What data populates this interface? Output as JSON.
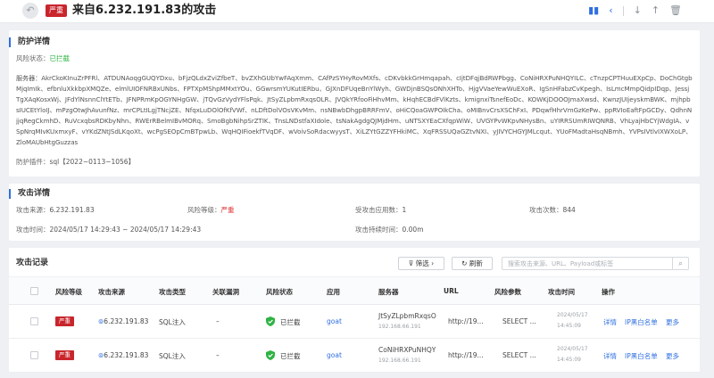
{
  "header": {
    "severity": "严重",
    "title": "来自6.232.191.83的攻击",
    "icons": [
      "bar-chart-icon",
      "chevron-left-icon",
      "arrow-down-icon",
      "arrow-up-icon",
      "trash-icon"
    ]
  },
  "defense": {
    "title": "防护详情",
    "status_label": "风险状态：",
    "status_value": "已拦截",
    "servers_label": "服务器：",
    "servers": "AkrCkoKInuZrPFRl、ATDUNAoqgGUQYDxu、bFjzQLdxZviZfbeT、bvZXhGUbYwFAqXmm、CAfPzSYHyRovMXfs、cDKvbkkGrHmqapah、cIjtDFqjBdRWPbgg、CoNiHRXPuNHQYILC、cTnzpCPTHuuEXpCp、DoChGtgbMjqImIk、efbnluXkkbpXMQZe、elmlUIOFNRBxUNbs、FPTXpMShpMMxtYOu、GGwrsmYUKutIERbu、GJXnDFUqeBnYlWyh、GWDjnBSQsONhXHTo、HjgVVaeYewWuEXoR、IgSnHFabzCvKpegh、IsLmcMmpQidpIDqp、JessjTgXAqKosxWj、JFdYlNsnnClYtETb、JFNPRmKpOGYNHgGW、jTQvGzVydYFlsPqk、JtSyZLpbmRxqsOLR、JVQkYRfooFiHhvMm、kHqhECBdFVlKzts、kmignxiTsnefEoDc、KOWKjDOOOJmaXwsd、KwnzJUIjeyskmBWK、mjhpbsIUCEtYloIJ、mPzgOtwJhAvunfNz、mrCPLtILgjTNcjZE、NfqxLuDOlOfKfVWf、nLDftDolVOsVKvMm、nsNBwbDhgpBRRFmV、oHiCQoaGWPOIkCha、oMIBnvCrsXSChFxI、PDqwfHhrVmGzKePw、ppRVIoEaftFpGCDy、QdhnNjjqRegCkmhD、RuVcxqbsRDKbyNhn、RWErRBelmIBvMORq、SmoBgbNihpSrZTIK、TnsLNDstfaXIdole、tsNakAgdgQJMjdHm、uNTSXYEaCXfqpWiW、UVGYPvWKpvNHysBn、uYIRRSUmRIWQNRB、VhLyajHbCYjWdgIA、vSpNrqMIvKUxmxyF、vYKdZNtJSdLKqoXt、wcPgSEOpCmBTpwLb、WqHQIFioekfTVqDF、wVoivSoRdacwyysT、XiLZYtGZZYFHkiMC、XqFRSSUQaGZtvNXI、yJIVYCHGYJMLcqut、YUoFMadtaHsqNBmh、YVPsIVtlvIXWXoLP、ZloMAUbHtgGuzzas",
    "plugin_label": "防护插件：",
    "plugin_value": "sql【2022−0113−1056】"
  },
  "attack": {
    "title": "攻击详情",
    "source_label": "攻击来源：",
    "source_value": "6.232.191.83",
    "level_label": "风险等级：",
    "level_value": "严重",
    "apps_label": "受攻击应用数：",
    "apps_value": "1",
    "count_label": "攻击次数：",
    "count_value": "844",
    "time_label": "攻击时间：",
    "time_value": "2024/05/17 14:29:43 ~ 2024/05/17 14:29:43",
    "duration_label": "攻击持续时间：",
    "duration_value": "0.00m"
  },
  "records": {
    "title": "攻击记录",
    "filter_label": "筛选",
    "refresh_label": "刷新",
    "search_placeholder": "搜索攻击来源、URL、Payload或标签",
    "columns": [
      "风险等级",
      "攻击来源",
      "攻击类型",
      "关联漏洞",
      "风险状态",
      "应用",
      "服务器",
      "URL",
      "风险参数",
      "攻击时间",
      "操作"
    ],
    "actions": {
      "detail": "详情",
      "whitelist": "IP黑白名单",
      "more": "更多"
    },
    "rows": [
      {
        "level": "严重",
        "source": "6.232.191.83",
        "type": "SQL注入",
        "vuln": "–",
        "status": "已拦截",
        "app": "goat",
        "server": "JtSyZLpbmRxqsO",
        "server_ip": "192.168.66.191",
        "url": "http://19...",
        "param": "SELECT ...",
        "date": "2024/05/17",
        "time": "14:45:09"
      },
      {
        "level": "严重",
        "source": "6.232.191.83",
        "type": "SQL注入",
        "vuln": "–",
        "status": "已拦截",
        "app": "goat",
        "server": "CoNiHRXPuNHQY",
        "server_ip": "192.168.66.191",
        "url": "http://19...",
        "param": "SELECT ...",
        "date": "2024/05/17",
        "time": "14:45:09"
      }
    ]
  }
}
